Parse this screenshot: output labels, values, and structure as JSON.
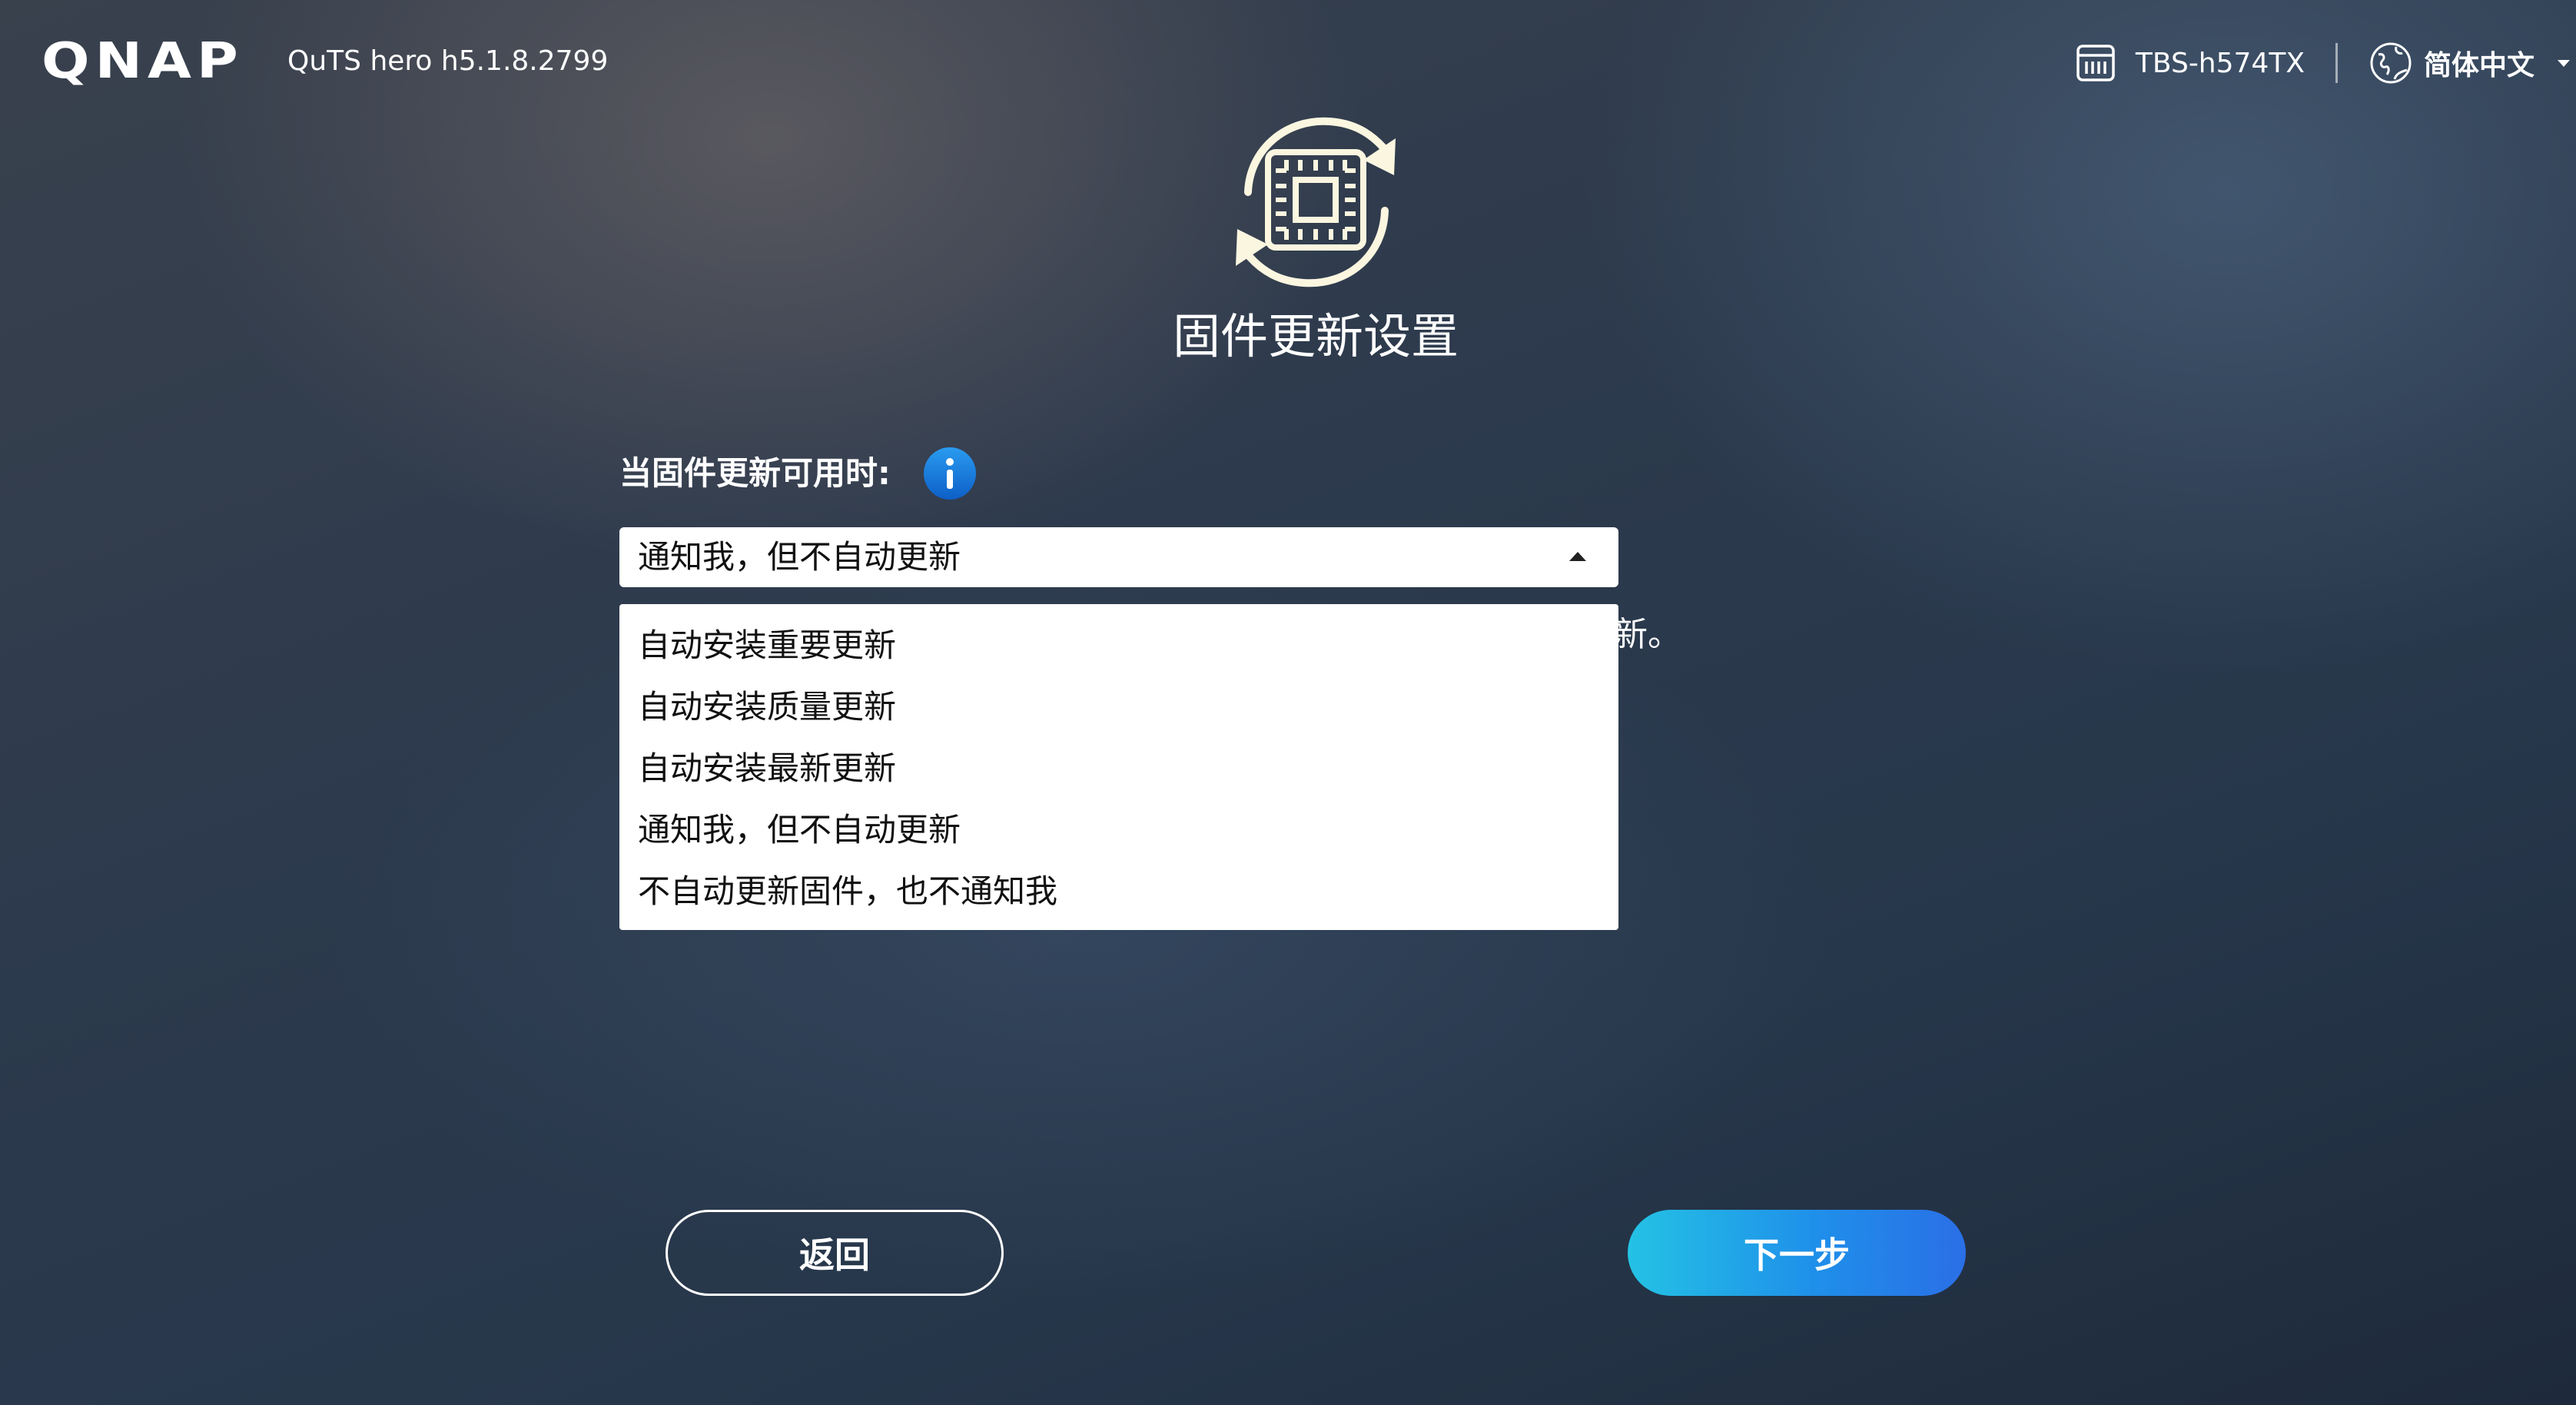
{
  "header": {
    "logo_text": "QNAP",
    "version": "QuTS hero h5.1.8.2799",
    "device_name": "TBS-h574TX",
    "language": "简体中文"
  },
  "hero": {
    "icon": "firmware-update-icon",
    "title": "固件更新设置"
  },
  "form": {
    "label": "当固件更新可用时:",
    "info_icon": "info-icon",
    "selected_value": "通知我，但不自动更新",
    "description_visible_fragment": "新。",
    "options": [
      "自动安装重要更新",
      "自动安装质量更新",
      "自动安装最新更新",
      "通知我，但不自动更新",
      "不自动更新固件，也不通知我"
    ]
  },
  "buttons": {
    "back": "返回",
    "next": "下一步"
  },
  "colors": {
    "accent_start": "#24c2e4",
    "accent_end": "#2a6fe6",
    "hero_icon": "#fbf6e0",
    "info_blue": "#1677d8"
  }
}
